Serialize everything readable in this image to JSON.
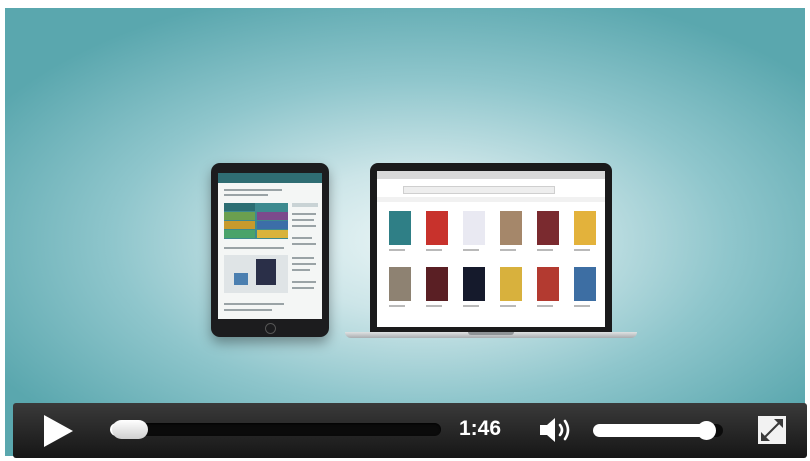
{
  "player": {
    "current_time": "1:46",
    "progress": 0.03,
    "volume": 0.88,
    "state": "paused"
  },
  "controls": {
    "play_icon": "play-icon",
    "volume_icon": "speaker-icon",
    "fullscreen_icon": "fullscreen-icon"
  },
  "colors": {
    "control_bar": "#1f1f1f",
    "video_background": "#8fc6cc",
    "tablet_header": "#2f6d73"
  }
}
